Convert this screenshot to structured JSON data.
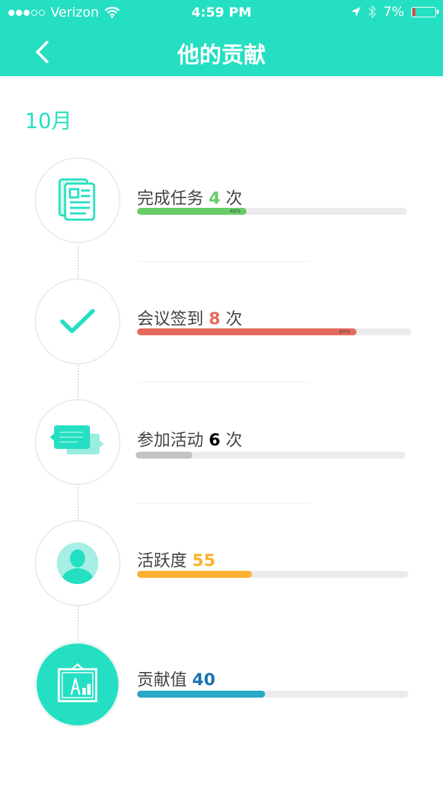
{
  "status_bar": {
    "carrier": "Verizon",
    "time": "4:59 PM",
    "battery": "7%"
  },
  "header": {
    "title": "他的贡献"
  },
  "month": "10月",
  "items": [
    {
      "label": "完成任务",
      "count": "4",
      "unit": "次",
      "progress": 0.4,
      "progress_label": "40%",
      "color": "#66cc66",
      "icon": "document-icon"
    },
    {
      "label": "会议签到",
      "count": "8",
      "unit": "次",
      "progress": 0.8,
      "progress_label": "80%",
      "color": "#e5695e",
      "icon": "checkmark-icon"
    },
    {
      "label": "参加活动",
      "count": "6",
      "unit": "次",
      "progress": 0.21,
      "progress_label": "",
      "color": "#c4c4c4",
      "count_color": "#000000",
      "icon": "chat-bubbles-icon"
    },
    {
      "label": "活跃度",
      "count": "55",
      "unit": "",
      "progress": 0.42,
      "progress_label": "",
      "color": "#fbb030",
      "icon": "person-icon"
    },
    {
      "label": "贡献值",
      "count": "40",
      "unit": "",
      "progress": 0.47,
      "progress_label": "",
      "color": "#29a8c8",
      "count_color": "#1a73b0",
      "icon": "award-board-icon"
    }
  ],
  "colors": {
    "accent": "#25dfc2"
  }
}
